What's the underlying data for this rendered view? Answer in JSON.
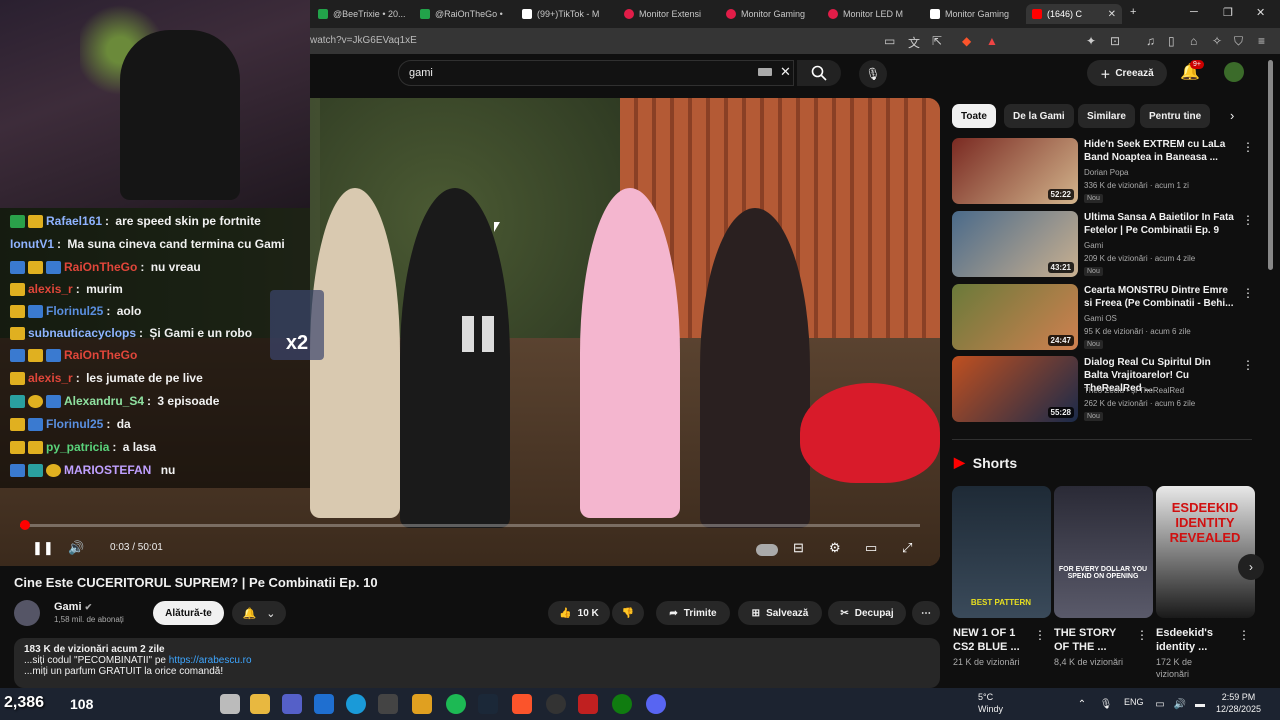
{
  "browser": {
    "tabs": [
      {
        "label": "@BeeTrixie • 20...",
        "color": "#22a34a"
      },
      {
        "label": "@RaiOnTheGo •",
        "color": "#22a34a"
      },
      {
        "label": "(99+)TikTok - M",
        "color": "#ffffff"
      },
      {
        "label": "Monitor Extensi",
        "color": "#e11d48"
      },
      {
        "label": "Monitor Gaming",
        "color": "#e11d48"
      },
      {
        "label": "Monitor LED M",
        "color": "#e11d48"
      },
      {
        "label": "Monitor Gaming",
        "color": "#ffffff"
      },
      {
        "label": "(1646) C",
        "color": "#ff0000"
      }
    ],
    "new_tab": "+",
    "url": "watch?v=JkG6EVaq1xE"
  },
  "youtube": {
    "search_value": "gami",
    "create_label": "Creează",
    "notif_badge": "9+"
  },
  "player": {
    "time": "0:03 / 50:01",
    "progress_fraction": 0.001
  },
  "stream": {
    "chat": [
      {
        "user": "Rafael161",
        "msg": "are speed skin pe fortnite",
        "color": "#8fb3ff"
      },
      {
        "user": "IonutV1",
        "msg": "Ma suna cineva cand termina cu Gami",
        "color": "#8fb3ff"
      },
      {
        "user": "RaiOnTheGo",
        "msg": "nu vreau",
        "color": "#e0463a"
      },
      {
        "user": "alexis_r",
        "msg": "murim",
        "color": "#e0463a"
      },
      {
        "user": "Florinul25",
        "msg": "aolo",
        "color": "#5a8fe0"
      },
      {
        "user": "subnauticacyclops",
        "msg": "Și Gami e un robo",
        "color": "#8fb3ff"
      },
      {
        "user": "RaiOnTheGo",
        "msg": "",
        "color": "#e0463a"
      },
      {
        "user": "alexis_r",
        "msg": "les jumate de pe live",
        "color": "#e0463a"
      },
      {
        "user": "Alexandru_S4",
        "msg": "3 episoade",
        "color": "#8fe0a0"
      },
      {
        "user": "Florinul25",
        "msg": "da",
        "color": "#5a8fe0"
      },
      {
        "user": "py_patricia",
        "msg": "a lasa",
        "color": "#5ad27a"
      },
      {
        "user": "MARIOSTEFAN",
        "msg": "nu",
        "color": "#c0a0ff"
      }
    ],
    "overlay_multiplier": "x2",
    "viewer_count": "2,386",
    "coins": "108"
  },
  "video": {
    "title": "Cine Este CUCERITORUL SUPREM? | Pe Combinatii Ep. 10",
    "channel": "Gami",
    "subscribers": "1,58 mil. de abonați",
    "join_label": "Alătură-te",
    "likes": "10 K",
    "share_label": "Trimite",
    "save_label": "Salvează",
    "clip_label": "Decupaj",
    "views_line": "183 K de vizionări  acum 2 zile",
    "desc_line1_prefix": "...siți codul \"PECOMBINATII\" pe",
    "desc_link": "https://arabescu.ro",
    "desc_line2": "...miți un parfum GRATUIT la orice comandă!"
  },
  "chips": [
    "Toate",
    "De la Gami",
    "Similare",
    "Pentru tine"
  ],
  "recommendations": [
    {
      "title": "Hide'n Seek EXTREM cu LaLa Band Noaptea in Baneasa ...",
      "channel": "Dorian Popa",
      "views": "336 K de vizionări · acum 1 zi",
      "duration": "52:22",
      "tag": "Nou",
      "thumb": "#7a2a22"
    },
    {
      "title": "Ultima Sansa A Baietilor In Fata Fetelor | Pe Combinatii Ep. 9",
      "channel": "Gami",
      "views": "209 K de vizionări · acum 4 zile",
      "duration": "43:21",
      "tag": "Nou",
      "thumb": "#4a6a8a"
    },
    {
      "title": "Cearta MONSTRU Dintre Emre si Freea (Pe Combinatii - Behi...",
      "channel": "Gami OS",
      "views": "95 K de vizionări · acum 6 zile",
      "duration": "24:47",
      "tag": "Nou",
      "thumb": "#6a7a3a"
    },
    {
      "title": "Dialog Real Cu Spiritul Din Balta Vrajitoarelor! Cu TheRealRed ...",
      "channel": "Theo Zeciu • și TheRealRed",
      "views": "262 K de vizionări · acum 6 zile",
      "duration": "55:28",
      "tag": "Nou",
      "thumb": "#2a3a5a"
    }
  ],
  "shorts": {
    "header": "Shorts",
    "items": [
      {
        "title": "NEW 1 OF 1 CS2 BLUE ...",
        "views": "21 K de vizionări",
        "thumb": "#2a3a4a",
        "caption": "BEST PATTERN"
      },
      {
        "title": "THE STORY OF THE ...",
        "views": "8,4 K de vizionări",
        "thumb": "#3a3a48",
        "caption": "FOR EVERY DOLLAR YOU SPEND ON OPENING"
      },
      {
        "title": "Esdeekid's identity ...",
        "views": "172 K de vizionări",
        "thumb": "#c8c8c8",
        "caption": "ESDEEKID IDENTITY REVEALED"
      }
    ]
  },
  "taskbar": {
    "weather_temp": "5°C",
    "weather_desc": "Windy",
    "lang": "ENG",
    "time": "2:59 PM",
    "date": "12/28/2025"
  }
}
